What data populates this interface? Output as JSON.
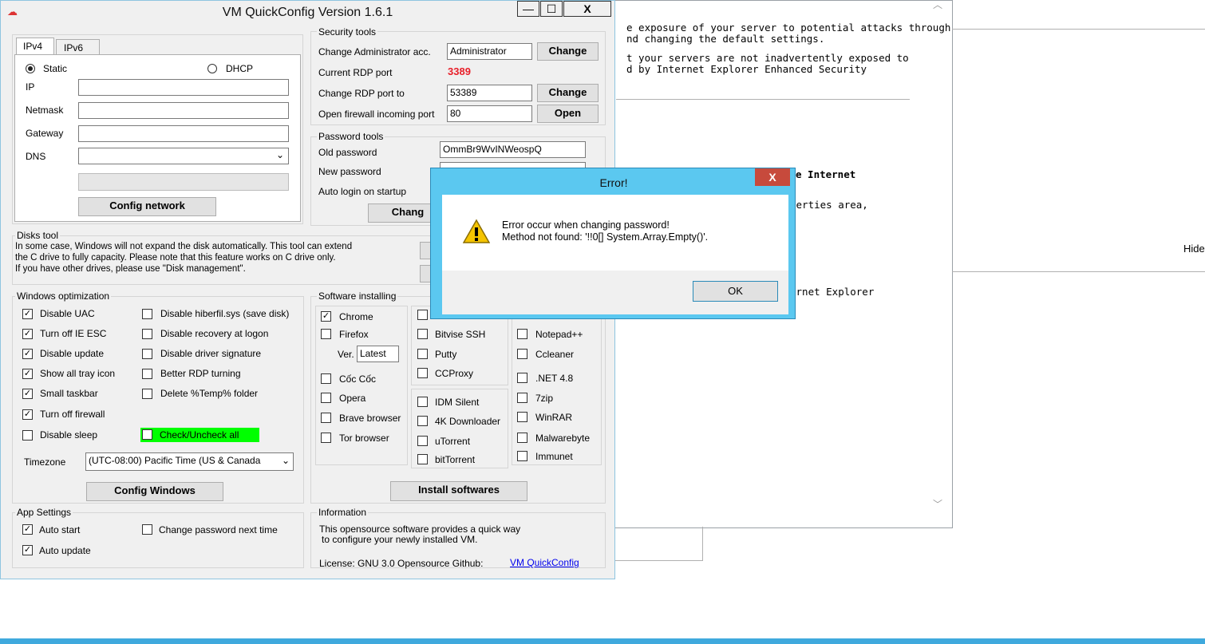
{
  "background_window": {
    "lines": [
      "e exposure of your server to potential attacks through",
      "nd changing the default settings.",
      "t your servers are not inadvertently exposed to",
      "d by Internet Explorer Enhanced Security"
    ],
    "frag_internet": "e Internet",
    "frag_properties": "perties area,",
    "frag_ie": "ernet Explorer",
    "hide": "Hide"
  },
  "app": {
    "title": "VM QuickConfig Version 1.6.1",
    "window_buttons": {
      "minimize": "—",
      "maximize": "☐",
      "close": "X"
    },
    "network": {
      "tabs": [
        "IPv4",
        "IPv6"
      ],
      "static": "Static",
      "dhcp": "DHCP",
      "ip_label": "IP",
      "netmask_label": "Netmask",
      "gateway_label": "Gateway",
      "dns_label": "DNS",
      "ip": "",
      "netmask": "",
      "gateway": "",
      "dns": "",
      "config_button": "Config network"
    },
    "security": {
      "legend": "Security tools",
      "admin_label": "Change Administrator acc.",
      "admin_value": "Administrator",
      "change1": "Change",
      "current_rdp_label": "Current RDP port",
      "current_rdp_value": "3389",
      "rdp_to_label": "Change RDP port to",
      "rdp_to_value": "53389",
      "change2": "Change",
      "firewall_label": "Open firewall incoming port",
      "firewall_value": "80",
      "open": "Open"
    },
    "password": {
      "legend": "Password tools",
      "old_label": "Old password",
      "old_value": "OmmBr9WvINWeospQ",
      "new_label": "New password",
      "auto_login_label": "Auto login on startup",
      "change_button": "Chang"
    },
    "disks": {
      "legend": "Disks tool",
      "text1": "In some case, Windows will not expand the disk automatically. This tool can extend",
      "text2": "the C drive to fully capacity. Please note that this feature works on C drive only.",
      "text3": "If you have other drives, please use \"Disk management\"."
    },
    "winopt": {
      "legend": "Windows optimization",
      "items_left": [
        {
          "label": "Disable UAC",
          "checked": "✓"
        },
        {
          "label": "Turn off IE ESC",
          "checked": "✓"
        },
        {
          "label": "Disable update",
          "checked": "✓"
        },
        {
          "label": "Show all tray icon",
          "checked": "✓"
        },
        {
          "label": "Small taskbar",
          "checked": "✓"
        },
        {
          "label": "Turn off firewall",
          "checked": "✓"
        },
        {
          "label": "Disable sleep",
          "checked": ""
        }
      ],
      "items_right": [
        {
          "label": "Disable hiberfil.sys (save disk)",
          "checked": ""
        },
        {
          "label": "Disable recovery at logon",
          "checked": ""
        },
        {
          "label": "Disable driver signature",
          "checked": ""
        },
        {
          "label": "Better RDP turning",
          "checked": ""
        },
        {
          "label": "Delete %Temp% folder",
          "checked": ""
        }
      ],
      "check_all": "Check/Uncheck all",
      "timezone_label": "Timezone",
      "timezone_value": "(UTC-08:00) Pacific Time (US & Canada",
      "config_button": "Config Windows"
    },
    "software": {
      "legend": "Software installing",
      "col1": [
        "Chrome",
        "Firefox",
        "Cốc Cốc",
        "Opera",
        "Brave browser",
        "Tor browser"
      ],
      "chrome_checked": "✓",
      "ver_label": "Ver.",
      "ver_value": "Latest",
      "col2": [
        "",
        "Bitvise SSH",
        "Putty",
        "CCProxy",
        "IDM Silent",
        "4K Downloader",
        "uTorrent",
        "bitTorrent"
      ],
      "col3": [
        "",
        "Notepad++",
        "Ccleaner",
        ".NET 4.8",
        "7zip",
        "WinRAR",
        "Malwarebyte",
        "Immunet"
      ],
      "install_button": "Install softwares"
    },
    "appsettings": {
      "legend": "App Settings",
      "auto_start": "Auto start",
      "auto_update": "Auto update",
      "change_pw_next": "Change password next time",
      "check": "✓"
    },
    "info": {
      "legend": "Information",
      "line1": "This opensource software provides a quick way",
      "line2": "to configure your newly installed VM.",
      "license": "License: GNU 3.0  Opensource Github:",
      "link": "VM QuickConfig"
    }
  },
  "dialog": {
    "title": "Error!",
    "close": "X",
    "message1": "Error occur when changing password!",
    "message2": "Method not found: '!!0[] System.Array.Empty()'.",
    "ok": "OK"
  },
  "colors": {
    "accent": "#5bc8f0",
    "rdp_port": "#e8202a",
    "highlight": "#00ff00",
    "link": "#0000ee"
  }
}
